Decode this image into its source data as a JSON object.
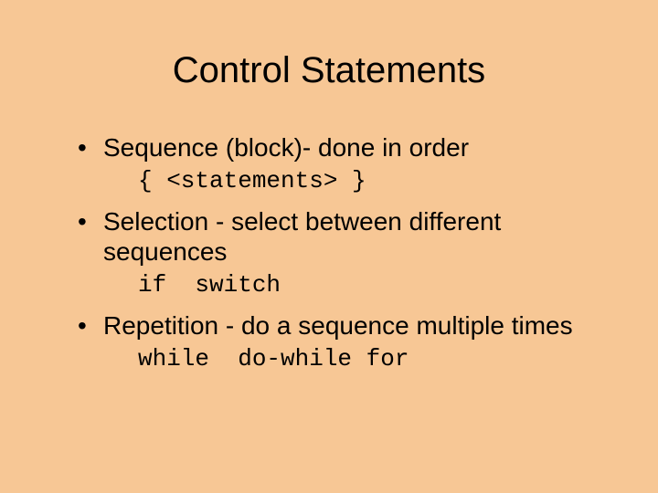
{
  "title": "Control Statements",
  "bullets": [
    {
      "text": "Sequence (block)- done in order",
      "code": "{ <statements> }"
    },
    {
      "text": "Selection - select between different sequences",
      "code": "if  switch"
    },
    {
      "text": "Repetition - do a sequence multiple times",
      "code": "while  do-while for"
    }
  ]
}
